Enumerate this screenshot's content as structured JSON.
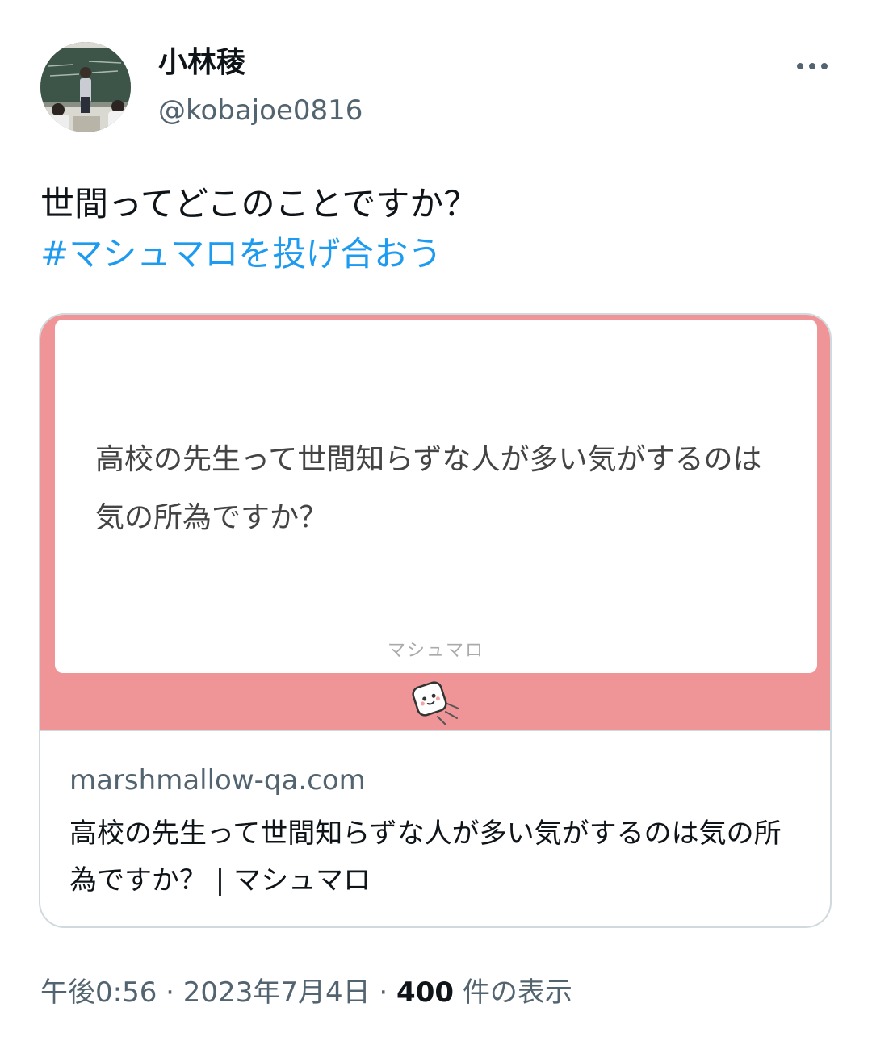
{
  "author": {
    "display_name": "小林稜",
    "handle": "@kobajoe0816"
  },
  "tweet": {
    "text": "世間ってどこのことですか？",
    "hashtag": "#マシュマロを投げ合おう"
  },
  "card": {
    "question": "高校の先生って世間知らずな人が多い気がするのは気の所為ですか？",
    "brand": "マシュマロ",
    "domain": "marshmallow-qa.com",
    "title": "高校の先生って世間知らずな人が多い気がするのは気の所為ですか？ | マシュマロ",
    "image_bg_color": "#f09597"
  },
  "meta": {
    "time": "午後0:56",
    "separator": "·",
    "date": "2023年7月4日",
    "views_count": "400",
    "views_label": "件の表示"
  },
  "icons": {
    "more": "more-horizontal-icon",
    "marshmallow": "marshmallow-icon"
  },
  "colors": {
    "link": "#1d9bf0",
    "secondary_text": "#536471",
    "primary_text": "#0f1419",
    "border": "#cfd9de"
  }
}
